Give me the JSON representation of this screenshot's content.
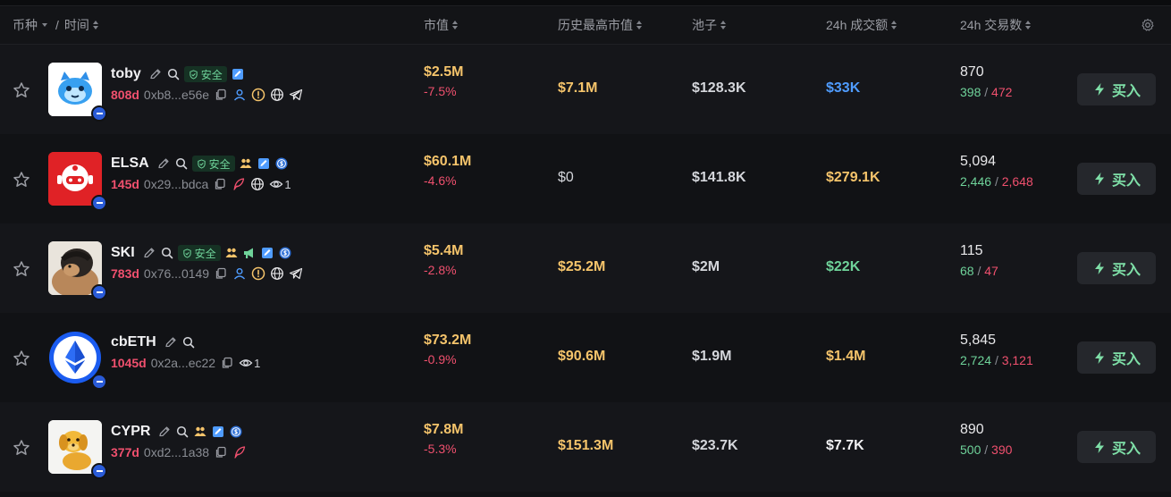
{
  "header": {
    "coin_label": "币种",
    "separator": "/",
    "time_label": "时间",
    "mcap_label": "市值",
    "ath_label": "历史最高市值",
    "pool_label": "池子",
    "volume_label": "24h 成交额",
    "txns_label": "24h 交易数"
  },
  "safe_label": "安全",
  "buy_label": "买入",
  "colors": {
    "gold": "#f5c46b",
    "neutral": "#d4d6db",
    "green": "#6fd39a",
    "blue": "#4f9cff",
    "red": "#f0506e",
    "white": "#f2f2f4"
  },
  "rows": [
    {
      "name": "toby",
      "age": "808d",
      "address": "0xb8...e56e",
      "mcap": "$2.5M",
      "change": "-7.5%",
      "ath": "$7.1M",
      "ath_color": "#f5c46b",
      "pool": "$128.3K",
      "volume": "$33K",
      "volume_color": "#4f9cff",
      "txns": "870",
      "buys": "398",
      "sells": "472",
      "watchers": ""
    },
    {
      "name": "ELSA",
      "age": "145d",
      "address": "0x29...bdca",
      "mcap": "$60.1M",
      "change": "-4.6%",
      "ath": "$0",
      "ath_color": "#d4d6db",
      "pool": "$141.8K",
      "volume": "$279.1K",
      "volume_color": "#f5c46b",
      "txns": "5,094",
      "buys": "2,446",
      "sells": "2,648",
      "watchers": "1"
    },
    {
      "name": "SKI",
      "age": "783d",
      "address": "0x76...0149",
      "mcap": "$5.4M",
      "change": "-2.8%",
      "ath": "$25.2M",
      "ath_color": "#f5c46b",
      "pool": "$2M",
      "volume": "$22K",
      "volume_color": "#6fd39a",
      "txns": "115",
      "buys": "68",
      "sells": "47",
      "watchers": ""
    },
    {
      "name": "cbETH",
      "age": "1045d",
      "address": "0x2a...ec22",
      "mcap": "$73.2M",
      "change": "-0.9%",
      "ath": "$90.6M",
      "ath_color": "#f5c46b",
      "pool": "$1.9M",
      "volume": "$1.4M",
      "volume_color": "#f5c46b",
      "txns": "5,845",
      "buys": "2,724",
      "sells": "3,121",
      "watchers": "1"
    },
    {
      "name": "CYPR",
      "age": "377d",
      "address": "0xd2...1a38",
      "mcap": "$7.8M",
      "change": "-5.3%",
      "ath": "$151.3M",
      "ath_color": "#f5c46b",
      "pool": "$23.7K",
      "volume": "$7.7K",
      "volume_color": "#f2f2f4",
      "txns": "890",
      "buys": "500",
      "sells": "390",
      "watchers": ""
    }
  ]
}
